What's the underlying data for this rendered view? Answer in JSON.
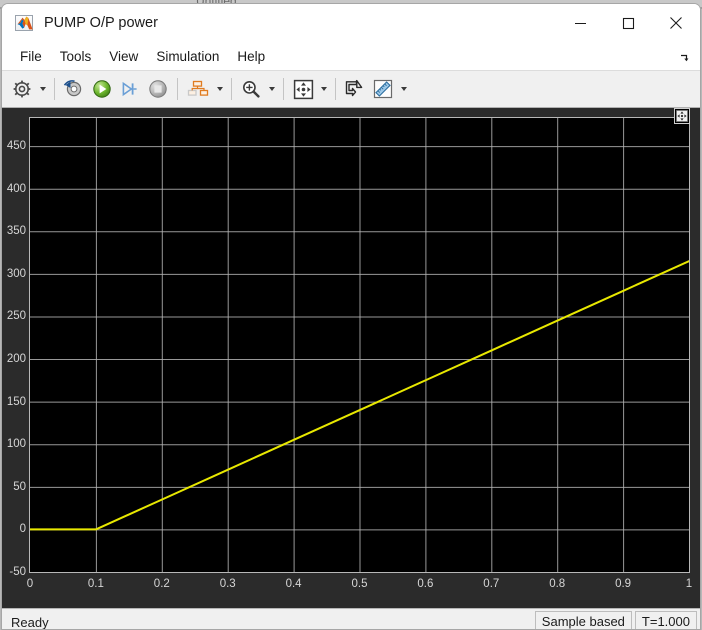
{
  "background_window": {
    "title": "Untitled"
  },
  "window": {
    "title": "PUMP O/P power",
    "icon": "matlab-logo-icon",
    "controls": {
      "minimize": "minimize-icon",
      "maximize": "maximize-icon",
      "close": "close-icon"
    }
  },
  "menubar": {
    "items": [
      {
        "label": "File"
      },
      {
        "label": "Tools"
      },
      {
        "label": "View"
      },
      {
        "label": "Simulation"
      },
      {
        "label": "Help"
      }
    ],
    "undock": "undock-arrow-icon"
  },
  "toolbar": {
    "buttons": [
      {
        "name": "configuration-properties-button",
        "icon": "gear-icon",
        "has_dropdown": true
      },
      {
        "name": "run-back-to-start-button",
        "icon": "rewind-icon",
        "has_dropdown": false
      },
      {
        "name": "run-button",
        "icon": "play-icon",
        "has_dropdown": false
      },
      {
        "name": "step-forward-button",
        "icon": "step-forward-icon",
        "has_dropdown": false
      },
      {
        "name": "stop-button",
        "icon": "stop-icon",
        "has_dropdown": false
      },
      {
        "name": "signal-selection-button",
        "icon": "signal-blocks-icon",
        "has_dropdown": true
      },
      {
        "name": "zoom-button",
        "icon": "magnifier-plus-icon",
        "has_dropdown": true
      },
      {
        "name": "autoscale-button",
        "icon": "fit-to-view-icon",
        "has_dropdown": true
      },
      {
        "name": "trigger-button",
        "icon": "trigger-arrow-icon",
        "has_dropdown": false
      },
      {
        "name": "measurements-button",
        "icon": "ruler-icon",
        "has_dropdown": true
      }
    ]
  },
  "plot": {
    "fit_button": "fit-to-view-small-icon"
  },
  "statusbar": {
    "status": "Ready",
    "frame_mode": "Sample based",
    "time": "T=1.000"
  },
  "chart_data": {
    "type": "line",
    "title": "",
    "xlabel": "",
    "ylabel": "",
    "xlim": [
      0,
      1
    ],
    "ylim": [
      -50,
      483
    ],
    "xticks": [
      0,
      0.1,
      0.2,
      0.3,
      0.4,
      0.5,
      0.6,
      0.7,
      0.8,
      0.9,
      1
    ],
    "xticklabels": [
      "0",
      "0.1",
      "0.2",
      "0.3",
      "0.4",
      "0.5",
      "0.6",
      "0.7",
      "0.8",
      "0.9",
      "1"
    ],
    "yticks": [
      -50,
      0,
      50,
      100,
      150,
      200,
      250,
      300,
      350,
      400,
      450
    ],
    "yticklabels": [
      "-50",
      "0",
      "50",
      "100",
      "150",
      "200",
      "250",
      "300",
      "350",
      "400",
      "450"
    ],
    "grid": true,
    "grid_color": "#b4b4b4",
    "background": "#000000",
    "series": [
      {
        "name": "PUMP O/P power",
        "color": "#e8e800",
        "line_width": 2,
        "x": [
          0,
          0.02,
          0.04,
          0.06,
          0.08,
          0.1,
          0.2,
          0.3,
          0.4,
          0.5,
          0.6,
          0.7,
          0.8,
          0.9,
          1
        ],
        "y": [
          0,
          0,
          0,
          0,
          0,
          0,
          35,
          70,
          105,
          140,
          175,
          210,
          245,
          280,
          315
        ]
      }
    ]
  }
}
